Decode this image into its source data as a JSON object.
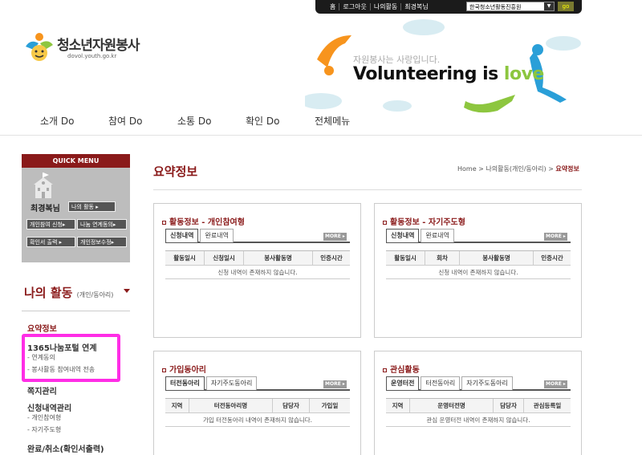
{
  "top_bar": {
    "links": [
      "홈",
      "로그아웃",
      "나의활동",
      "최경복님"
    ],
    "org_select": "한국청소년활동진흥원",
    "go_label": "go"
  },
  "logo": {
    "title": "청소년자원봉사",
    "url": "dovol.youth.go.kr"
  },
  "banner": {
    "tagline": "자원봉사는 사랑입니다.",
    "headline_main": "Volunteering is ",
    "headline_accent": "love"
  },
  "nav": [
    "소개 Do",
    "참여 Do",
    "소통 Do",
    "확인 Do",
    "전체메뉴"
  ],
  "quick_menu": {
    "header": "QUICK MENU",
    "user_name": "최경복님",
    "buttons": [
      "나의 활동 ▸",
      "개인참여 신청▸",
      "나눔 연계동의▸",
      "확인서 출력 ▸",
      "개인정보수정▸"
    ]
  },
  "left_menu": {
    "title": "나의 활동",
    "title_sub": "(개인/동아리)",
    "items": [
      {
        "label": "요약정보",
        "subs": []
      },
      {
        "label": "1365나눔포털 연계",
        "subs": [
          "- 연계동의",
          "- 봉사활동 참여내역 전송"
        ]
      },
      {
        "label": "쪽지관리",
        "subs": []
      },
      {
        "label": "신청내역관리",
        "subs": [
          "- 개인참여형",
          "- 자기주도형"
        ]
      },
      {
        "label": "완료/취소(확인서출력)",
        "subs": []
      }
    ]
  },
  "content": {
    "page_title": "요약정보",
    "breadcrumb": {
      "home": "Home",
      "sep": " > ",
      "mid": "나의활동(개인/동아리)",
      "current": "요약정보"
    },
    "more_label": "MORE ▸",
    "panels": [
      {
        "title": "활동정보 - 개인참여형",
        "tabs": [
          "신청내역",
          "완료내역"
        ],
        "columns": [
          "활동일시",
          "신청일시",
          "봉사활동명",
          "인증시간"
        ],
        "empty": "신청 내역이 존재하지 않습니다."
      },
      {
        "title": "활동정보 - 자기주도형",
        "tabs": [
          "신청내역",
          "완료내역"
        ],
        "columns": [
          "활동일시",
          "회차",
          "봉사활동명",
          "인증시간"
        ],
        "empty": "신청 내역이 존재하지 않습니다."
      },
      {
        "title": "가입동아리",
        "tabs": [
          "터전동아리",
          "자기주도동아리"
        ],
        "columns": [
          "지역",
          "터전동아리명",
          "담당자",
          "가입일"
        ],
        "empty": "가입 터전동아리 내역이 존재하지 않습니다."
      },
      {
        "title": "관심활동",
        "tabs": [
          "운영터전",
          "터전동아리",
          "자기주도동아리"
        ],
        "columns": [
          "지역",
          "운영터전명",
          "담당자",
          "관심등록일"
        ],
        "empty": "관심 운영터전 내역이 존재하지 않습니다."
      }
    ]
  },
  "colors": {
    "brand": "#8a1a1a",
    "highlight": "#ff2de6",
    "accent": "#8cc63f"
  }
}
